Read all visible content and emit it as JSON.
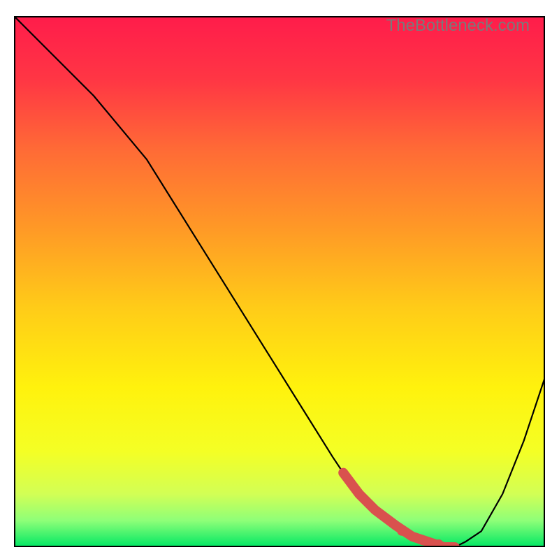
{
  "watermark": "TheBottleneck.com",
  "chart_data": {
    "type": "line",
    "title": "",
    "xlabel": "",
    "ylabel": "",
    "xlim": [
      0,
      100
    ],
    "ylim": [
      0,
      100
    ],
    "tick_labels_visible": false,
    "curve": {
      "x": [
        0,
        5,
        10,
        15,
        20,
        25,
        30,
        35,
        40,
        45,
        50,
        55,
        60,
        62,
        65,
        68,
        72,
        75,
        78,
        81,
        83,
        85,
        88,
        92,
        96,
        100
      ],
      "y": [
        100,
        95,
        90,
        85,
        79,
        73,
        65,
        57,
        49,
        41,
        33,
        25,
        17,
        14,
        10,
        7,
        4,
        2,
        1,
        0,
        0,
        1,
        3,
        10,
        20,
        32
      ]
    },
    "thick_accent_segment": {
      "color": "#d9514e",
      "x": [
        62,
        65,
        68,
        72,
        75,
        78,
        81,
        83
      ],
      "y": [
        14,
        10,
        7,
        4,
        2,
        1,
        0,
        0
      ]
    },
    "accent_dots": {
      "color": "#d9514e",
      "points": [
        {
          "x": 73,
          "y": 3
        },
        {
          "x": 75,
          "y": 2
        },
        {
          "x": 77,
          "y": 1.2
        },
        {
          "x": 80,
          "y": 0.6
        }
      ]
    },
    "background_gradient": {
      "type": "vertical",
      "stops": [
        {
          "offset": 0.0,
          "color": "#ff1c4b"
        },
        {
          "offset": 0.12,
          "color": "#ff3644"
        },
        {
          "offset": 0.25,
          "color": "#ff6a36"
        },
        {
          "offset": 0.4,
          "color": "#ff9926"
        },
        {
          "offset": 0.55,
          "color": "#ffcc18"
        },
        {
          "offset": 0.7,
          "color": "#fff20d"
        },
        {
          "offset": 0.82,
          "color": "#f4ff25"
        },
        {
          "offset": 0.9,
          "color": "#d2ff55"
        },
        {
          "offset": 0.95,
          "color": "#8eff78"
        },
        {
          "offset": 1.0,
          "color": "#00e764"
        }
      ]
    }
  }
}
